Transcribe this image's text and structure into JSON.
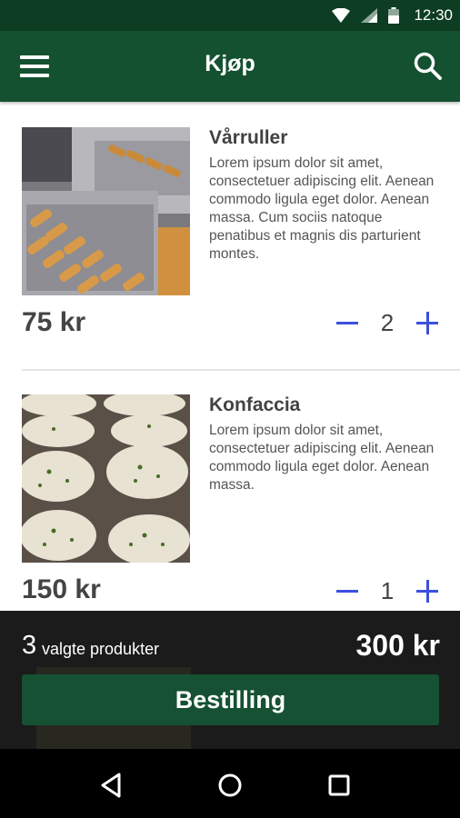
{
  "status": {
    "time": "12:30"
  },
  "appbar": {
    "title": "Kjøp"
  },
  "items": [
    {
      "name": "Vårruller",
      "description": "Lorem ipsum dolor sit amet, consectetuer adipiscing elit. Aenean commodo ligula eget dolor. Aenean massa. Cum sociis natoque penatibus et magnis dis parturient montes.",
      "price": "75 kr",
      "quantity": "2"
    },
    {
      "name": "Konfaccia",
      "description": "Lorem ipsum dolor sit amet, consectetuer adipiscing elit. Aenean commodo ligula eget dolor. Aenean massa.",
      "price": "150 kr",
      "quantity": "1"
    }
  ],
  "summary": {
    "count": "3",
    "count_label": "valgte produkter",
    "total": "300 kr"
  },
  "order": {
    "label": "Bestilling"
  },
  "colors": {
    "appbar": "#145131",
    "statusbar": "#0d3d22",
    "accent": "#3b4fe0",
    "bottombar": "#1b1b1b"
  }
}
